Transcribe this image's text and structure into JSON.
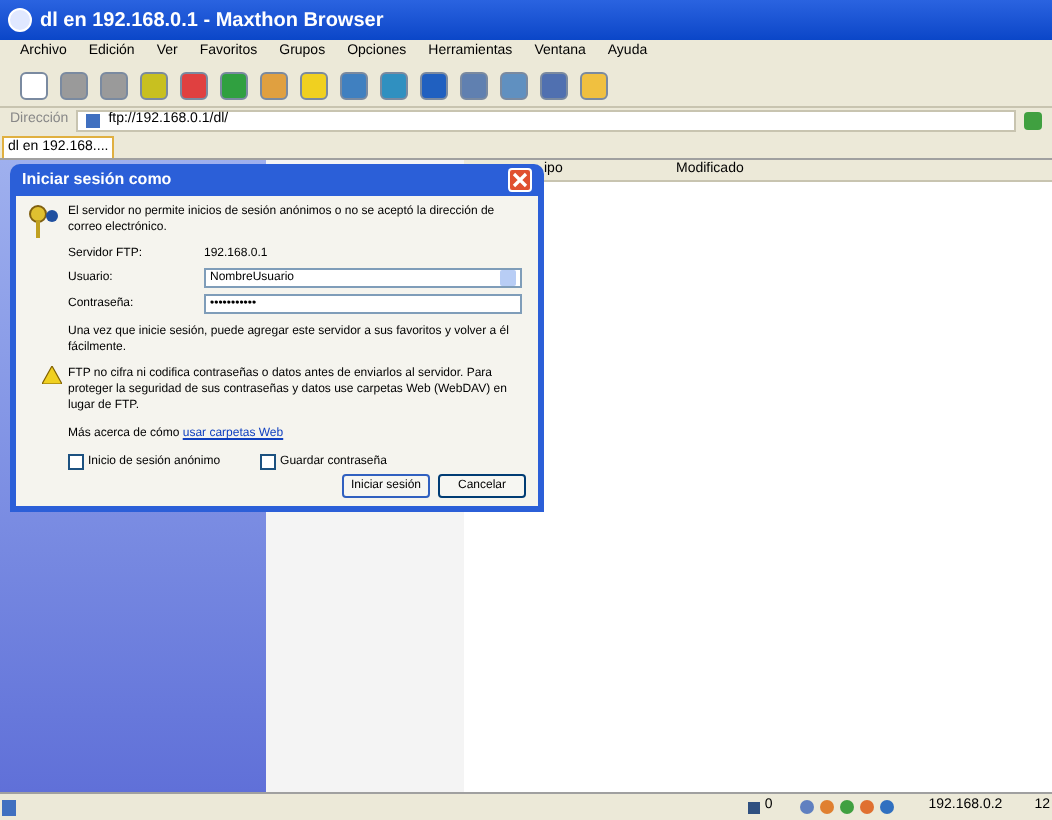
{
  "window": {
    "title": "dl en 192.168.0.1 - Maxthon Browser"
  },
  "menu": [
    "Archivo",
    "Edición",
    "Ver",
    "Favoritos",
    "Grupos",
    "Opciones",
    "Herramientas",
    "Ventana",
    "Ayuda"
  ],
  "address_bar": {
    "label": "Dirección",
    "url": "ftp://192.168.0.1/dl/"
  },
  "tabs": [
    {
      "label": "dl en 192.168....",
      "selected": true
    }
  ],
  "columns": [
    "ipo",
    "Modificado"
  ],
  "dialog": {
    "title": "Iniciar sesión como",
    "message": "El servidor no permite inicios de sesión anónimos o no se aceptó la dirección de correo electrónico.",
    "server_label": "Servidor FTP:",
    "server_value": "192.168.0.1",
    "user_label": "Usuario:",
    "user_value": "NombreUsuario",
    "password_label": "Contraseña:",
    "password_value": "•••••••••••",
    "info": "Una vez que inicie sesión, puede agregar este servidor a sus favoritos y volver a él fácilmente.",
    "warning": "FTP no cifra ni codifica contraseñas o datos antes de enviarlos al servidor.  Para proteger la seguridad de sus contraseñas y datos use carpetas Web (WebDAV) en lugar de FTP.",
    "more_text": "Más acerca de cómo",
    "more_link": "usar carpetas Web",
    "checkboxes": [
      {
        "label": "Inicio de sesión anónimo",
        "checked": false
      },
      {
        "label": "Guardar contraseña",
        "checked": false
      }
    ],
    "buttons": [
      "Iniciar sesión",
      "Cancelar"
    ]
  },
  "status_bar": {
    "count": "0",
    "ip": "192.168.0.2",
    "extra": "12"
  }
}
